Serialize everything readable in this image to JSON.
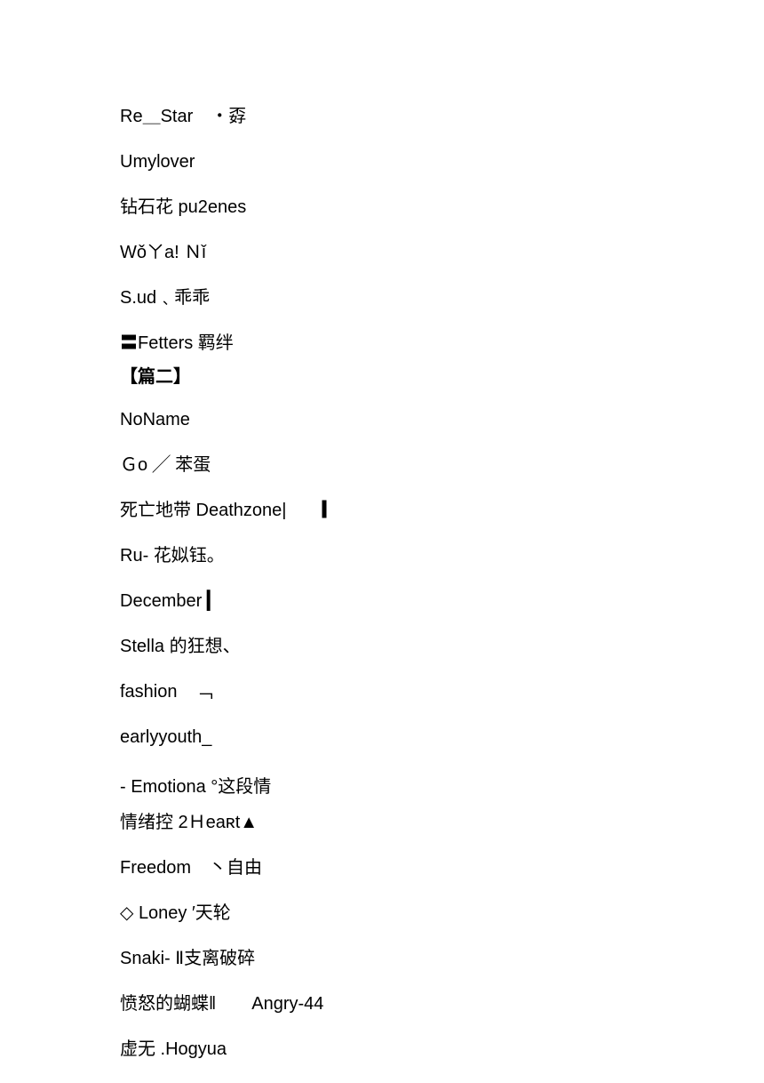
{
  "lines": [
    "Re＿Star　・孬",
    "Umylover",
    "钻石花 pu2enes",
    "Wǒㄚa! Ｎǐ",
    "S.ud﹑乖乖",
    "〓Fetters 羁绊"
  ],
  "section2_label": "【篇二】",
  "lines2": [
    "NoName",
    "Ｇo ╱ 苯蛋",
    "死亡地带 Deathzone|　　▎",
    "Ru- 花姒钰。",
    "December ▎",
    "Stella 的狂想、",
    "fashion　﹁",
    "earlyyouth_"
  ],
  "line_emotiona": "- Emotiona °这段情",
  "line_heart": "情绪控 2Ｈеаʀt▲",
  "lines3": [
    "Freedom　丶自由",
    "◇ Loney ′天轮",
    "Snaki- Ⅱ支离破碎",
    "愤怒的蝴蝶‖　　Angry-44",
    "虚无 .Hogyua"
  ]
}
